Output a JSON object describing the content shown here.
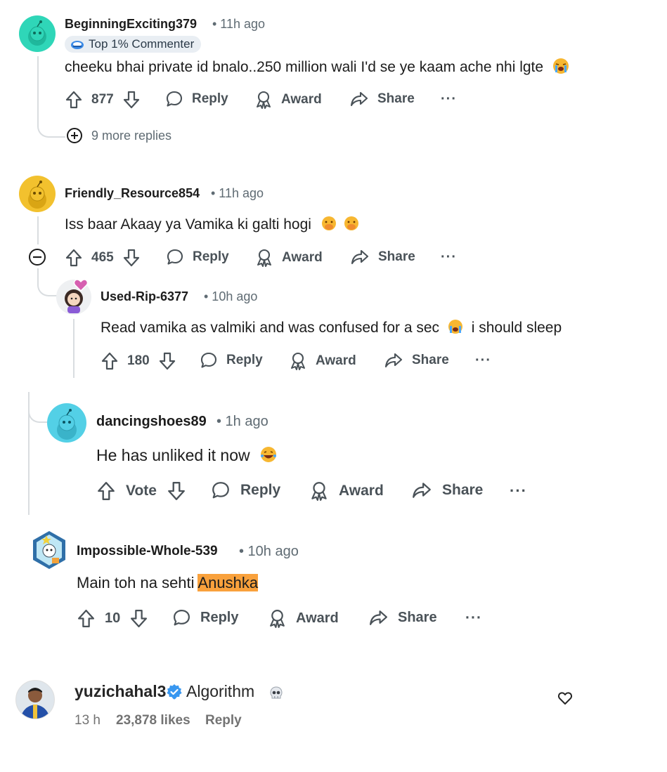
{
  "comments": [
    {
      "username": "BeginningExciting379",
      "time": "• 11h ago",
      "badge": "Top 1% Commenter",
      "text": "cheeku bhai private id bnalo..250 million wali I'd se ye kaam ache nhi lgte",
      "votes": "877",
      "more_replies": "9 more replies"
    },
    {
      "username": "Friendly_Resource854",
      "time": "• 11h ago",
      "text": "Iss baar Akaay ya Vamika ki galti hogi",
      "votes": "465"
    },
    {
      "username": "Used-Rip-6377",
      "time": "• 10h ago",
      "text_before": "Read vamika as valmiki and was confused for a sec",
      "text_after": "i should sleep",
      "votes": "180"
    },
    {
      "username": "dancingshoes89",
      "time": "• 1h ago",
      "text": "He has unliked it now",
      "votes": "Vote"
    },
    {
      "username": "Impossible-Whole-539",
      "time": "• 10h ago",
      "text_before": "Main toh na sehti",
      "text_highlight": "Anushka",
      "votes": "10"
    }
  ],
  "actions": {
    "reply": "Reply",
    "award": "Award",
    "share": "Share",
    "more": "···"
  },
  "instagram": {
    "username": "yuzichahal3",
    "text": "Algorithm",
    "time": "13 h",
    "likes": "23,878 likes",
    "reply": "Reply"
  },
  "colors": {
    "highlight": "#f9a13c",
    "verified": "#3897f0",
    "avatar_teal": "#2fd6b8",
    "avatar_yellow": "#f2c12e",
    "avatar_cyan": "#53d0e6"
  }
}
